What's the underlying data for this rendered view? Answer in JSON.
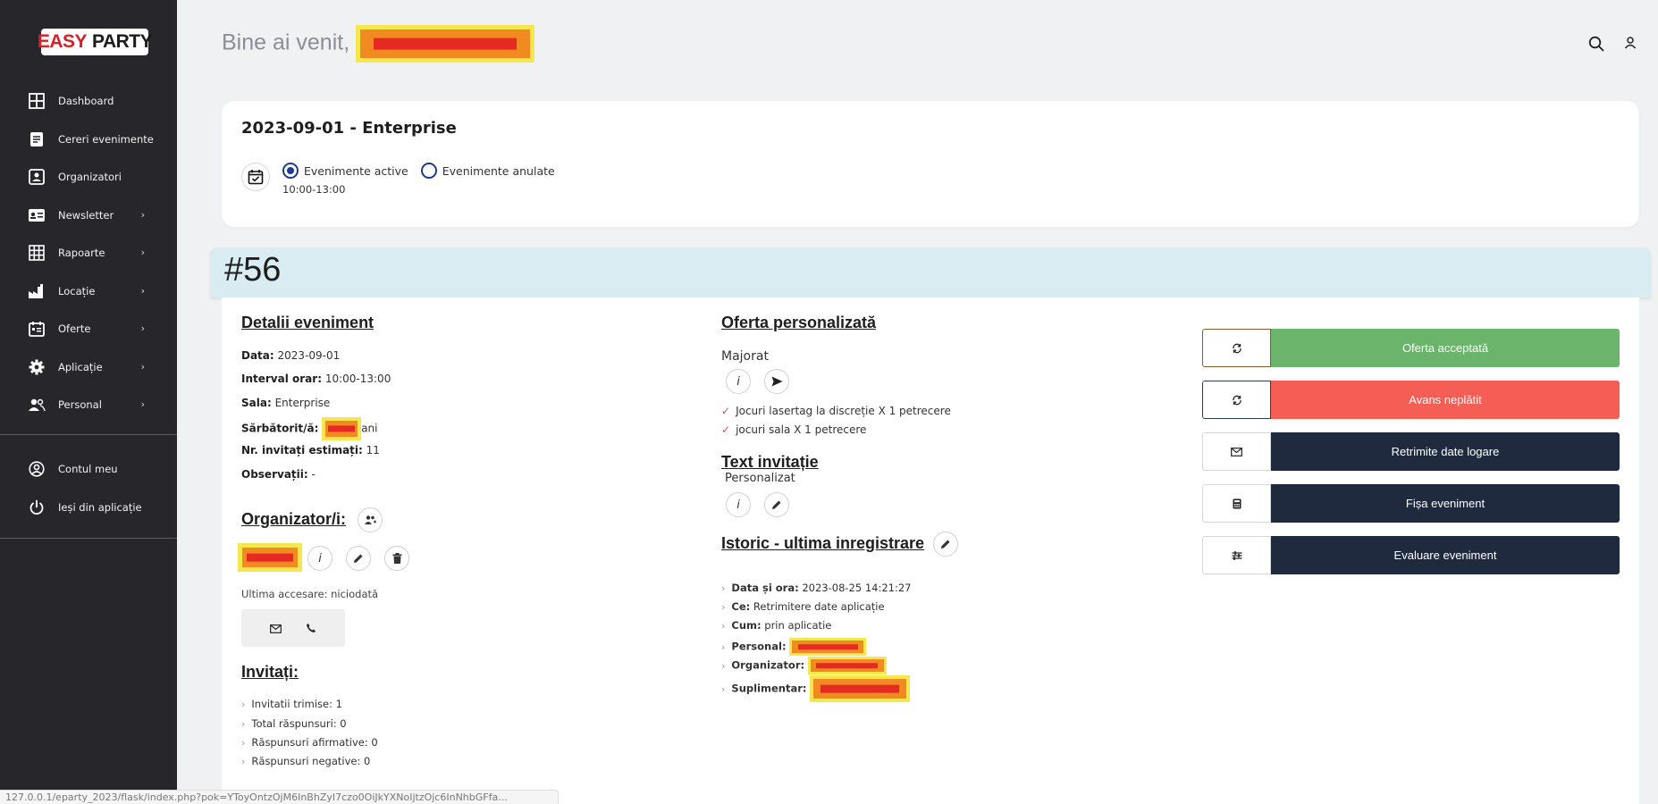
{
  "brand": {
    "easy": "EASY",
    "party": "PARTY"
  },
  "sidebar": {
    "items": [
      {
        "label": "Dashboard",
        "icon": "dashboard-grid-icon"
      },
      {
        "label": "Cereri evenimente",
        "icon": "document-icon"
      },
      {
        "label": "Organizatori",
        "icon": "contact-card-icon"
      },
      {
        "label": "Newsletter",
        "icon": "id-card-icon",
        "chevron": "›"
      },
      {
        "label": "Rapoarte",
        "icon": "table-grid-icon",
        "chevron": "›"
      },
      {
        "label": "Locație",
        "icon": "factory-icon",
        "chevron": "›"
      },
      {
        "label": "Oferte",
        "icon": "calendar-list-icon",
        "chevron": "›"
      },
      {
        "label": "Aplicație",
        "icon": "gear-icon",
        "chevron": "›"
      },
      {
        "label": "Personal",
        "icon": "people-icon",
        "chevron": "›"
      }
    ],
    "bottom": [
      {
        "label": "Contul meu",
        "icon": "account-circle-icon"
      },
      {
        "label": "Ieși din aplicație",
        "icon": "power-icon"
      }
    ]
  },
  "header": {
    "welcome": "Bine ai venit,"
  },
  "event_card": {
    "title": "2023-09-01 - Enterprise",
    "radio_active": "Evenimente active",
    "radio_cancelled": "Evenimente anulate",
    "hours": "10:00-13:00"
  },
  "event_number": "#56",
  "details": {
    "title": "Detalii eveniment",
    "data_label": "Data:",
    "data_value": "2023-09-01",
    "interval_label": "Interval orar:",
    "interval_value": "10:00-13:00",
    "sala_label": "Sala:",
    "sala_value": "Enterprise",
    "sarbatorit_label": "Sărbătorit/ă:",
    "sarbatorit_suffix": "ani",
    "invitati_label": "Nr. invitați estimați:",
    "invitati_value": "11",
    "observatii_label": "Observații:",
    "observatii_value": "-"
  },
  "organizers": {
    "title": "Organizator/i:",
    "info_glyph": "i",
    "last_access": "Ultima accesare: niciodată"
  },
  "guests": {
    "title": "Invitați:",
    "items": [
      "Invitatii trimise: 1",
      "Total răspunsuri: 0",
      "Răspunsuri afirmative: 0",
      "Răspunsuri negative: 0"
    ]
  },
  "offer": {
    "title": "Oferta personalizată",
    "type": "Majorat",
    "info_glyph": "i",
    "items": [
      "Jocuri lasertag la discreție X 1 petrecere",
      "jocuri sala X 1 petrecere"
    ],
    "check": "✓"
  },
  "invitation": {
    "title": "Text invitație",
    "value": "Personalizat",
    "info_glyph": "i"
  },
  "history": {
    "title": "Istoric - ultima inregistrare",
    "rows": [
      {
        "label": "Data și ora:",
        "value": "2023-08-25 14:21:27"
      },
      {
        "label": "Ce:",
        "value": "Retrimitere date aplicație"
      },
      {
        "label": "Cum:",
        "value": "prin aplicatie"
      },
      {
        "label": "Personal:",
        "value": ""
      },
      {
        "label": "Organizator:",
        "value": ""
      },
      {
        "label": "Suplimentar:",
        "value": ""
      }
    ],
    "chevron": "›"
  },
  "actions": [
    {
      "label": "Oferta acceptată",
      "color": "#6ab46c",
      "border": "#8a5a2a",
      "icon": "refresh-icon"
    },
    {
      "label": "Avans neplătit",
      "color": "#f45e55",
      "border": "#2d3b4a",
      "icon": "refresh-icon"
    },
    {
      "label": "Retrimite date logare",
      "color": "#1f2a3f",
      "border": "#d5d5d5",
      "icon": "mail-icon"
    },
    {
      "label": "Fișa eveniment",
      "color": "#1f2a3f",
      "border": "#d5d5d5",
      "icon": "calculator-icon"
    },
    {
      "label": "Evaluare eveniment",
      "color": "#1f2a3f",
      "border": "#d5d5d5",
      "icon": "sliders-icon"
    }
  ],
  "status_url": "127.0.0.1/eparty_2023/flask/index.php?pok=YToyOntzOjM6InBhZyI7czo0OiJkYXNoIjtzOjc6InNhbGFfa..."
}
